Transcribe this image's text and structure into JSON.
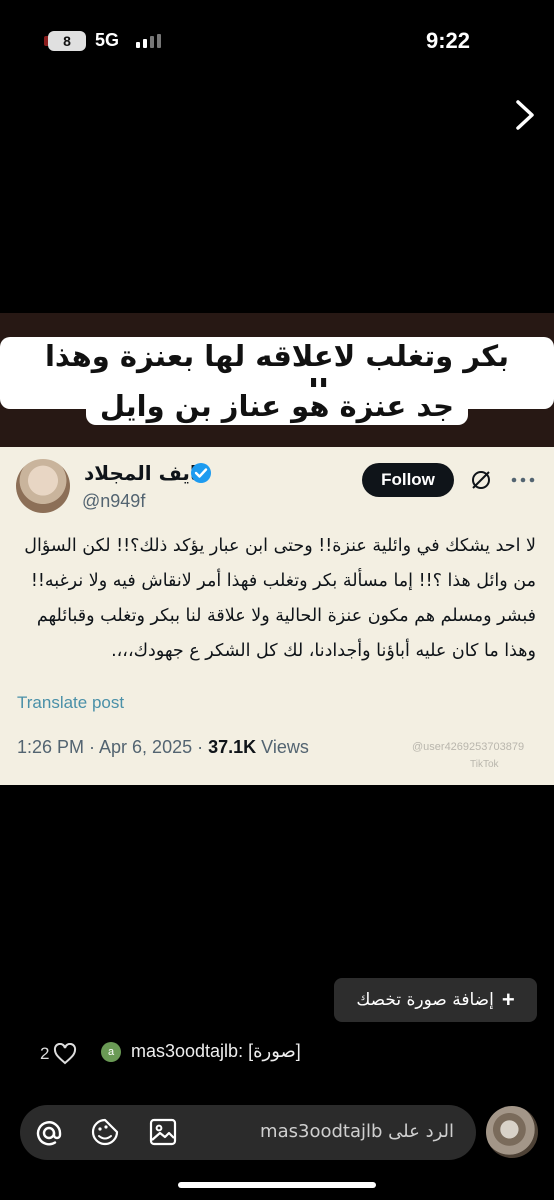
{
  "status_bar": {
    "battery": "8",
    "network": "5G",
    "time": "9:22"
  },
  "story": {
    "banner_line_1": "بكر وتغلب لاعلاقه لها بعنزة وهذا الصحيح",
    "banner_line_2": "جد عنزة هو عناز بن وايل",
    "tweet": {
      "display_name": "نايف المجلاد",
      "handle": "@n949f",
      "follow_label": "Follow",
      "body": "لا احد يشكك في وائلية عنزة!! وحتى ابن عبار يؤكد ذلك؟!! لكن السؤال من وائل هذا ؟!! إما مسألة بكر وتغلب فهذا أمر لانقاش فيه ولا نرغبه!! فبشر ومسلم هم مكون عنزة الحالية ولا علاقة لنا ببكر وتغلب وقبائلهم وهذا ما كان عليه أباؤنا وأجدادنا، لك كل الشكر ع جهودك،،،.",
      "translate_label": "Translate post",
      "time": "1:26 PM · Apr 6, 2025 · ",
      "views_count": "37.1K",
      "views_label": " Views",
      "watermark": "@user4269253703879",
      "watermark_brand": "TikTok"
    }
  },
  "actions": {
    "add_photo_label": "إضافة صورة تخصك",
    "like_count": "2",
    "reply_avatar_letter": "a",
    "reply_text": "mas3oodtajlb: [صورة]",
    "reply_placeholder": "الرد على mas3oodtajlb"
  },
  "icons": {
    "next": "chevron-right-icon",
    "verified": "verified-badge-icon",
    "grok": "grok-icon",
    "more": "more-icon",
    "heart": "heart-icon",
    "at": "at-icon",
    "sticker": "sticker-icon",
    "image": "image-icon"
  },
  "colors": {
    "background": "#000000",
    "banner": "#271814",
    "tweet_background": "#f3efe2",
    "verified": "#1d9bf0",
    "reply_bar": "#2b2b2b"
  }
}
